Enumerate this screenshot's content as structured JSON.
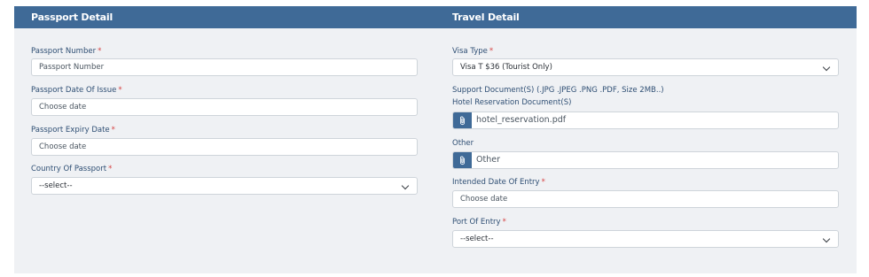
{
  "header": {
    "left_title": "Passport Detail",
    "right_title": "Travel Detail"
  },
  "required_mark": "*",
  "passport": {
    "number_label": "Passport Number",
    "number_placeholder": "Passport Number",
    "issue_label": "Passport Date Of Issue",
    "issue_placeholder": "Choose date",
    "expiry_label": "Passport Expiry Date",
    "expiry_placeholder": "Choose date",
    "country_label": "Country Of Passport",
    "country_value": "--select--"
  },
  "travel": {
    "visa_label": "Visa Type",
    "visa_value": "Visa T $36 (Tourist Only)",
    "support_label": "Support Document(S) (.JPG .JPEG .PNG .PDF, Size 2MB..)",
    "hotel_label": "Hotel Reservation Document(S)",
    "hotel_file": "hotel_reservation.pdf",
    "other_label": "Other",
    "other_file": "Other",
    "entry_date_label": "Intended Date Of Entry",
    "entry_date_placeholder": "Choose date",
    "port_label": "Port Of Entry",
    "port_value": "--select--"
  },
  "icons": {
    "attach": "paperclip-icon",
    "dropdown": "chevron-down-icon"
  },
  "colors": {
    "header_bg": "#3f6a97",
    "panel_bg": "#eff1f4",
    "required": "#d64545",
    "attach_button": "#3f6a97"
  }
}
